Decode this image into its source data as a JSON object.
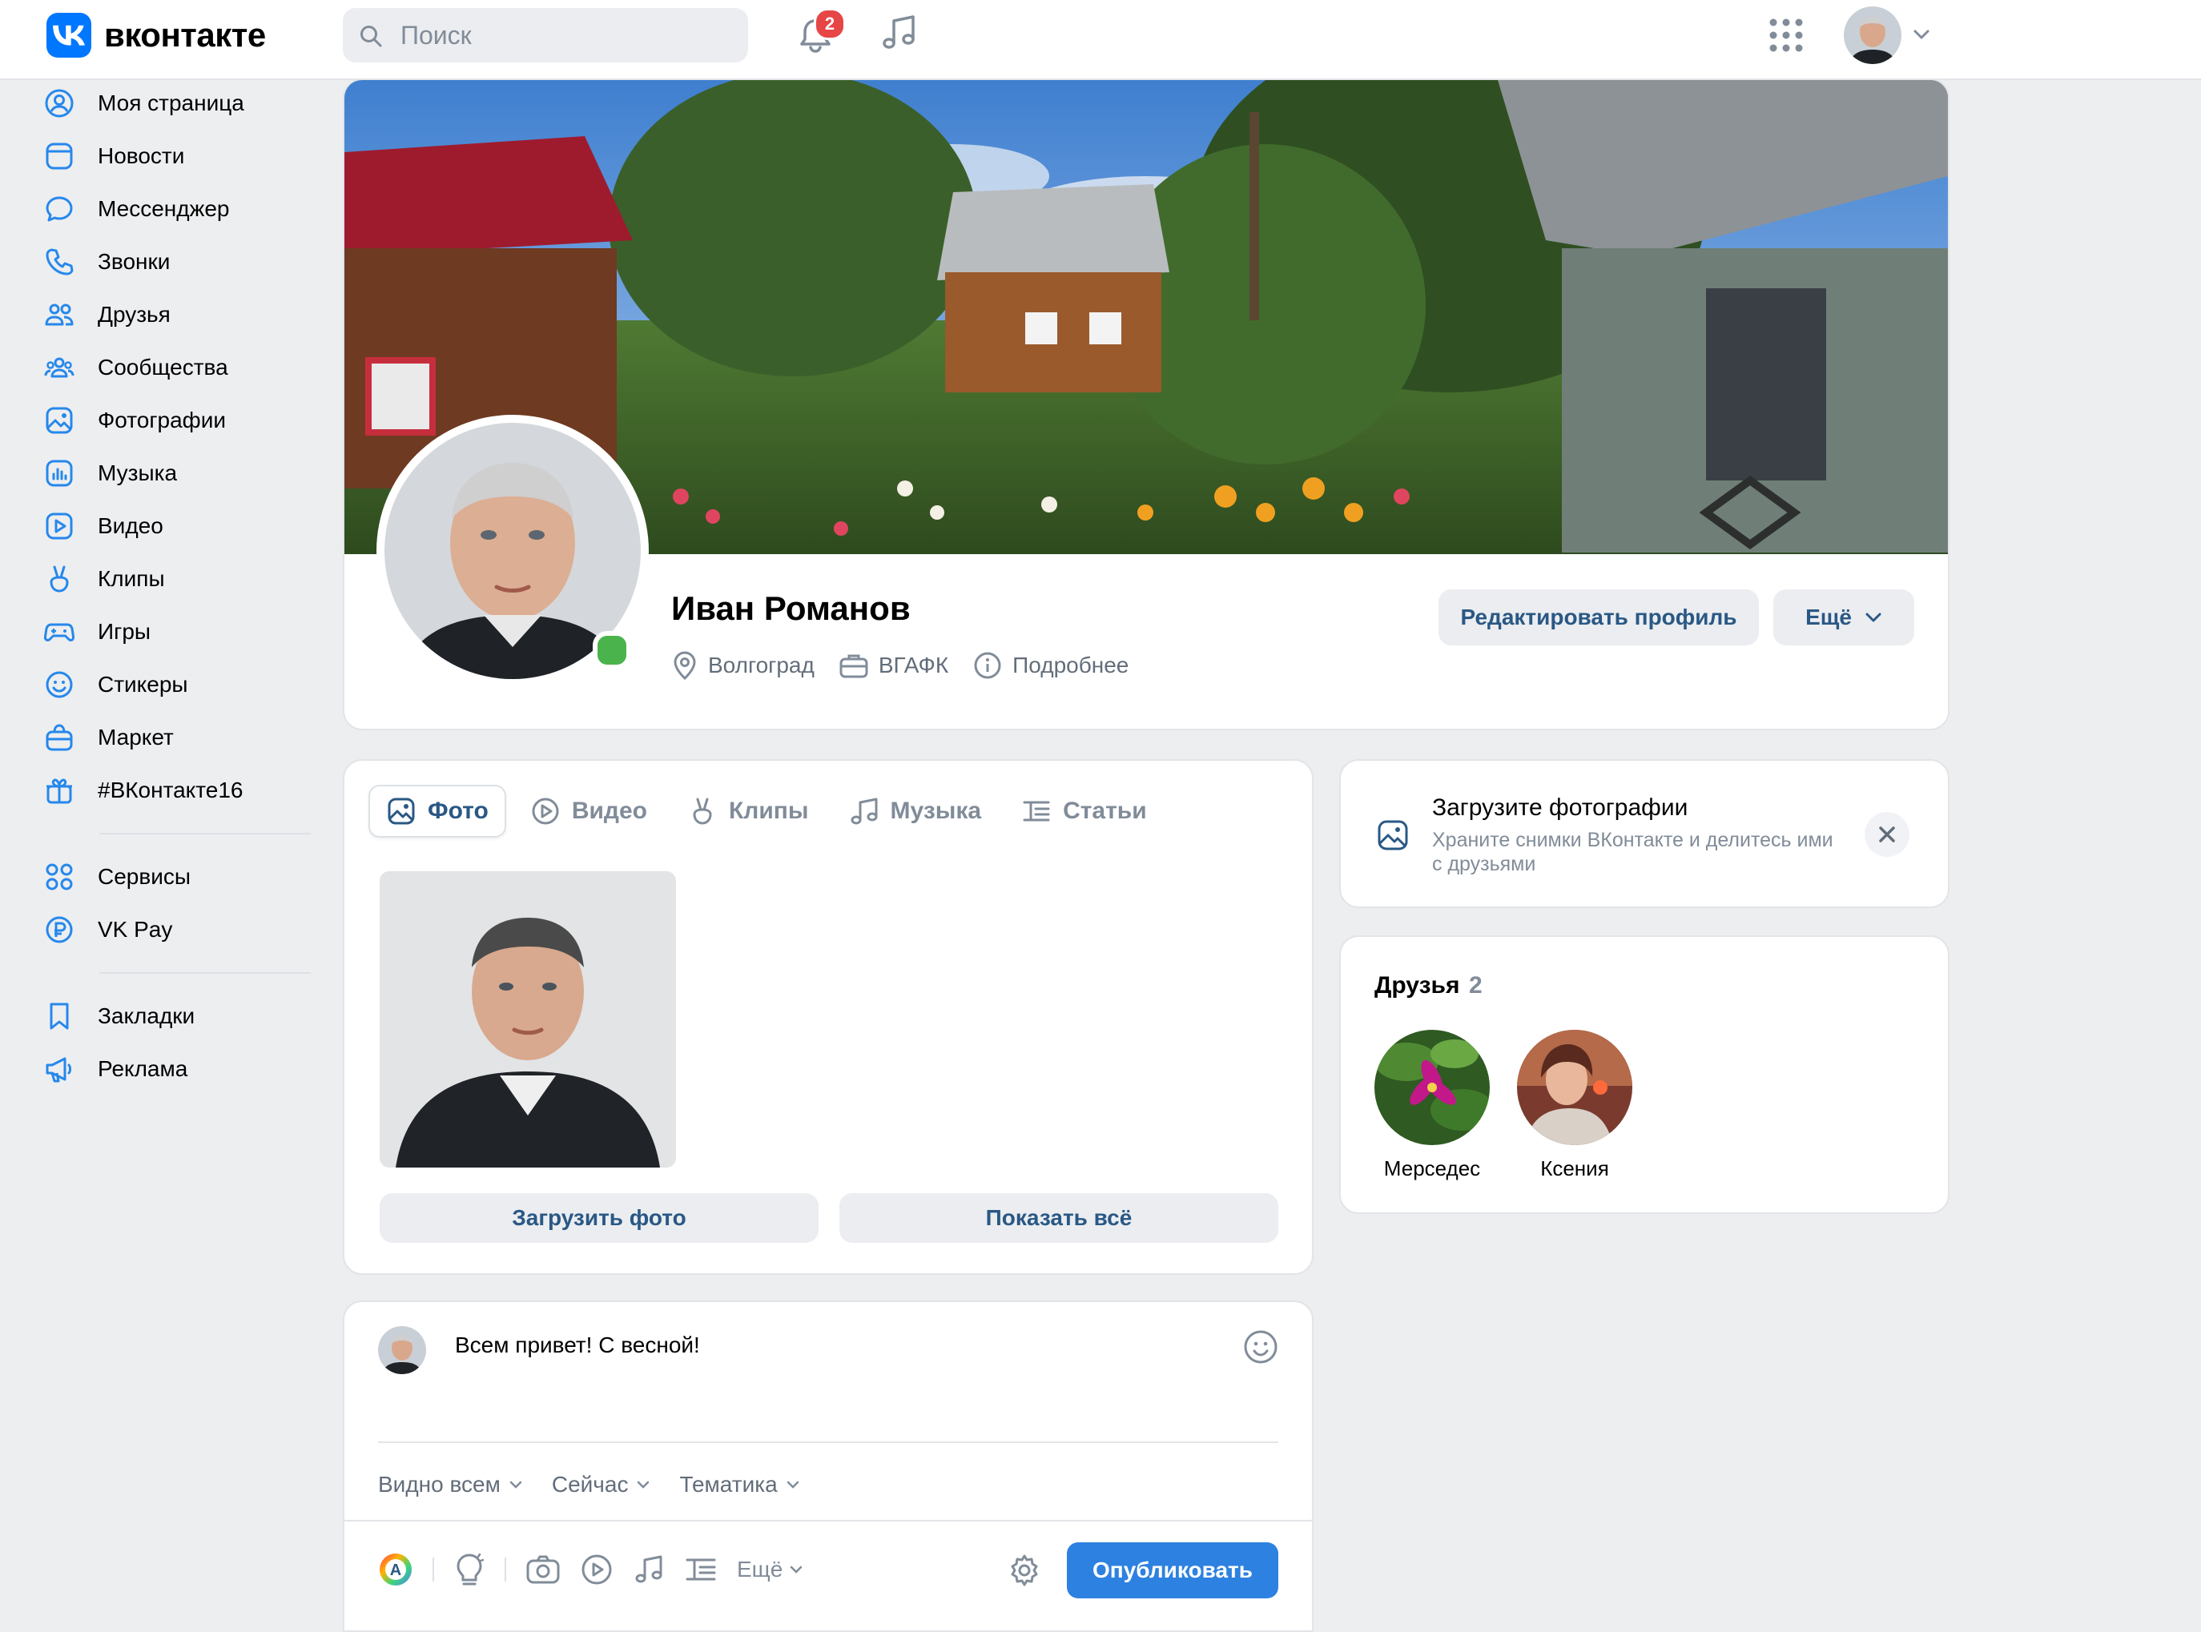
{
  "app": {
    "brand_name": "вконтакте",
    "logo_letters": "VK"
  },
  "search": {
    "placeholder": "Поиск"
  },
  "header": {
    "notifications_count": "2"
  },
  "sidebar": {
    "items": [
      {
        "label": "Моя страница",
        "icon": "user-circle-icon"
      },
      {
        "label": "Новости",
        "icon": "news-icon"
      },
      {
        "label": "Мессенджер",
        "icon": "message-icon"
      },
      {
        "label": "Звонки",
        "icon": "phone-icon"
      },
      {
        "label": "Друзья",
        "icon": "friends-icon"
      },
      {
        "label": "Сообщества",
        "icon": "communities-icon"
      },
      {
        "label": "Фотографии",
        "icon": "photos-icon"
      },
      {
        "label": "Музыка",
        "icon": "music-icon"
      },
      {
        "label": "Видео",
        "icon": "video-icon"
      },
      {
        "label": "Клипы",
        "icon": "clips-icon"
      },
      {
        "label": "Игры",
        "icon": "games-icon"
      },
      {
        "label": "Стикеры",
        "icon": "stickers-icon"
      },
      {
        "label": "Маркет",
        "icon": "market-icon"
      },
      {
        "label": "#ВКонтакте16",
        "icon": "gift-icon"
      }
    ],
    "items2": [
      {
        "label": "Сервисы",
        "icon": "services-icon"
      },
      {
        "label": "VK Pay",
        "icon": "vkpay-icon"
      }
    ],
    "items3": [
      {
        "label": "Закладки",
        "icon": "bookmark-icon"
      },
      {
        "label": "Реклама",
        "icon": "ads-icon"
      }
    ]
  },
  "profile": {
    "name": "Иван Романов",
    "city": "Волгоград",
    "education": "ВГАФК",
    "details": "Подробнее",
    "edit_button": "Редактировать профиль",
    "more_button": "Ещё"
  },
  "media": {
    "tabs": [
      {
        "label": "Фото",
        "icon": "photo-icon",
        "active": true
      },
      {
        "label": "Видео",
        "icon": "video-icon"
      },
      {
        "label": "Клипы",
        "icon": "clips-icon"
      },
      {
        "label": "Музыка",
        "icon": "music-icon"
      },
      {
        "label": "Статьи",
        "icon": "articles-icon"
      }
    ],
    "upload_button": "Загрузить фото",
    "show_all_button": "Показать всё"
  },
  "post": {
    "text": "Всем привет! С весной!",
    "visibility": "Видно всем",
    "time": "Сейчас",
    "topic": "Тематика",
    "tools_more": "Ещё",
    "publish_button": "Опубликовать"
  },
  "upload_hint": {
    "title": "Загрузите фотографии",
    "description": "Храните снимки ВКонтакте и делитесь ими с друзьями"
  },
  "friends": {
    "title": "Друзья",
    "count": "2",
    "list": [
      {
        "name": "Мерседес"
      },
      {
        "name": "Ксения"
      }
    ]
  },
  "colors": {
    "brand": "#0077ff",
    "link": "#2a5885",
    "primary_button": "#2d81e0",
    "online": "#4bb34b",
    "badge": "#e64646",
    "page_bg": "#edeef0"
  }
}
